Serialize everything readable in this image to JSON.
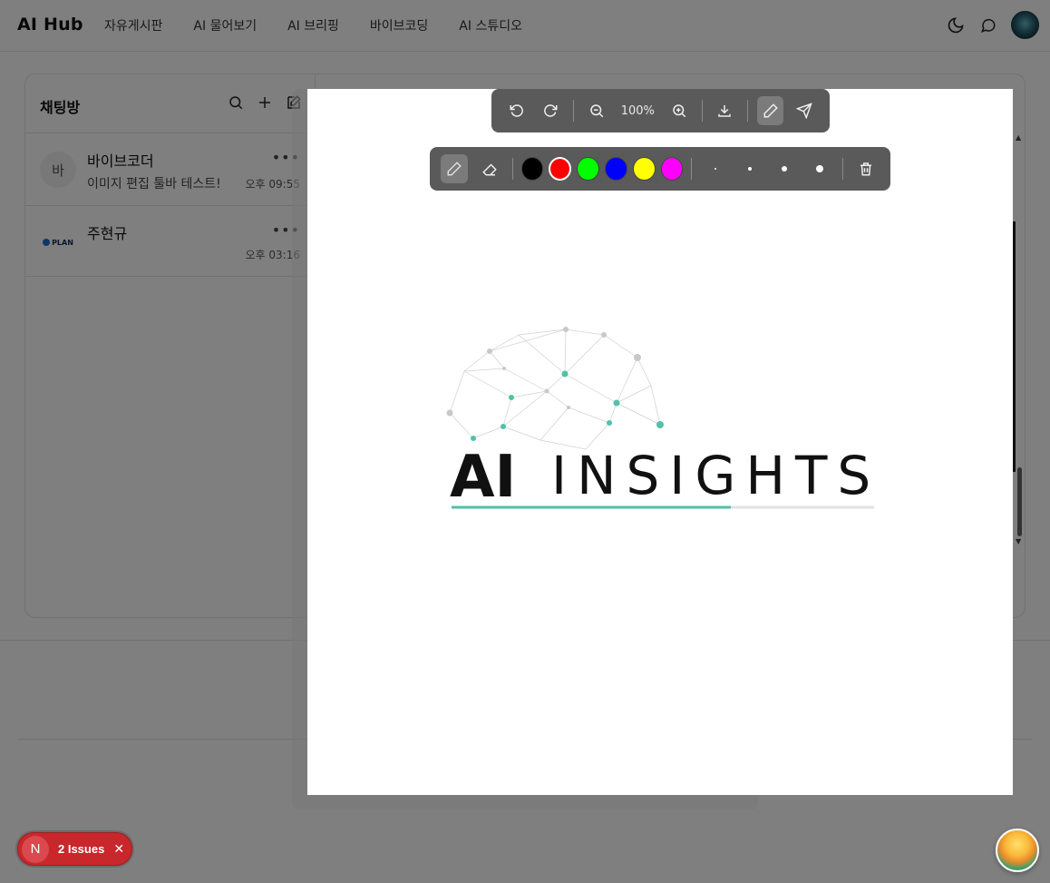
{
  "app": {
    "title": "AI Hub"
  },
  "nav": {
    "links": [
      "자유게시판",
      "AI 물어보기",
      "AI 브리핑",
      "바이브코딩",
      "AI 스튜디오"
    ]
  },
  "sidebar": {
    "title": "채팅방",
    "rooms": [
      {
        "avatar_text": "바",
        "name": "바이브코더",
        "last_message": "이미지 편집 툴바 테스트!",
        "time": "오후 09:55"
      },
      {
        "avatar_text": "PLAN",
        "name": "주현규",
        "last_message": "",
        "time": "오후 03:16"
      }
    ]
  },
  "editor": {
    "zoom": "100%",
    "colors": [
      "#000000",
      "#ff0000",
      "#00ff00",
      "#0000ff",
      "#ffff00",
      "#ff00ff"
    ],
    "selected_color": "#ff0000",
    "brush_sizes": [
      2,
      4,
      6,
      8
    ],
    "image_text": {
      "word1": "AI",
      "word2": "INSIGHTS"
    }
  },
  "issues_badge": {
    "initial": "N",
    "label": "2 Issues"
  }
}
